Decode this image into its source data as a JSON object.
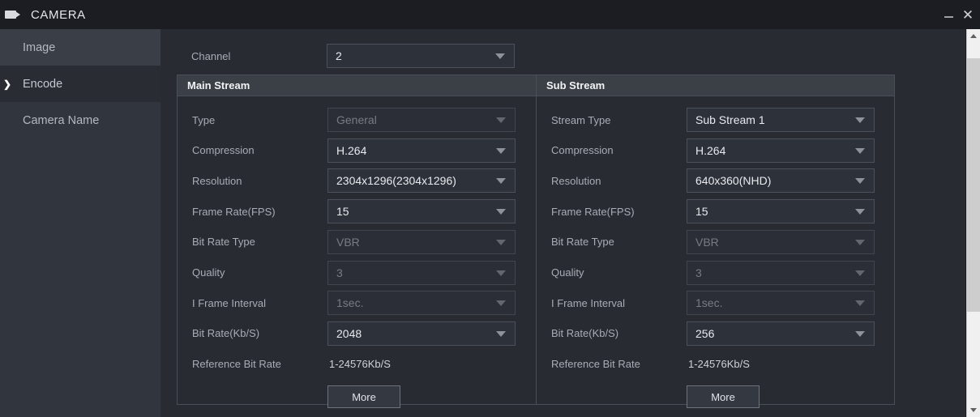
{
  "window": {
    "title": "CAMERA",
    "icon": "video-camera-icon",
    "minimize_label": "",
    "close_label": "✕"
  },
  "sidebar": {
    "items": [
      {
        "label": "Image",
        "state": "hover",
        "chevron": ""
      },
      {
        "label": "Encode",
        "state": "selected",
        "chevron": "❯"
      },
      {
        "label": "Camera Name",
        "state": "normal",
        "chevron": ""
      }
    ]
  },
  "channel": {
    "label": "Channel",
    "value": "2"
  },
  "panels": [
    {
      "title": "Main Stream",
      "rows": [
        {
          "label": "Type",
          "kind": "select",
          "value": "General",
          "disabled": true
        },
        {
          "label": "Compression",
          "kind": "select",
          "value": "H.264",
          "disabled": false
        },
        {
          "label": "Resolution",
          "kind": "select",
          "value": "2304x1296(2304x1296)",
          "disabled": false
        },
        {
          "label": "Frame Rate(FPS)",
          "kind": "select",
          "value": "15",
          "disabled": false
        },
        {
          "label": "Bit Rate Type",
          "kind": "select",
          "value": "VBR",
          "disabled": true
        },
        {
          "label": "Quality",
          "kind": "select",
          "value": "3",
          "disabled": true
        },
        {
          "label": "I Frame Interval",
          "kind": "select",
          "value": "1sec.",
          "disabled": true
        },
        {
          "label": "Bit Rate(Kb/S)",
          "kind": "select",
          "value": "2048",
          "disabled": false
        },
        {
          "label": "Reference Bit Rate",
          "kind": "text",
          "value": "1-24576Kb/S",
          "disabled": false
        }
      ],
      "more_label": "More"
    },
    {
      "title": "Sub Stream",
      "rows": [
        {
          "label": "Stream Type",
          "kind": "select",
          "value": "Sub Stream 1",
          "disabled": false
        },
        {
          "label": "Compression",
          "kind": "select",
          "value": "H.264",
          "disabled": false
        },
        {
          "label": "Resolution",
          "kind": "select",
          "value": "640x360(NHD)",
          "disabled": false
        },
        {
          "label": "Frame Rate(FPS)",
          "kind": "select",
          "value": "15",
          "disabled": false
        },
        {
          "label": "Bit Rate Type",
          "kind": "select",
          "value": "VBR",
          "disabled": true
        },
        {
          "label": "Quality",
          "kind": "select",
          "value": "3",
          "disabled": true
        },
        {
          "label": "I Frame Interval",
          "kind": "select",
          "value": "1sec.",
          "disabled": true
        },
        {
          "label": "Bit Rate(Kb/S)",
          "kind": "select",
          "value": "256",
          "disabled": false
        },
        {
          "label": "Reference Bit Rate",
          "kind": "text",
          "value": "1-24576Kb/S",
          "disabled": false
        }
      ],
      "more_label": "More"
    }
  ],
  "scrollbar": {
    "up_icon": "chevron-up-icon",
    "down_icon": "chevron-down-icon"
  },
  "colors": {
    "window_bg": "#1b1d23",
    "sidebar_bg": "#31353d",
    "content_bg": "#282b32",
    "panel_head_bg": "#3b3f46",
    "border": "#4a4e57",
    "text": "#e8eaee",
    "text_muted": "#a8acb4",
    "text_disabled": "#767b85"
  }
}
